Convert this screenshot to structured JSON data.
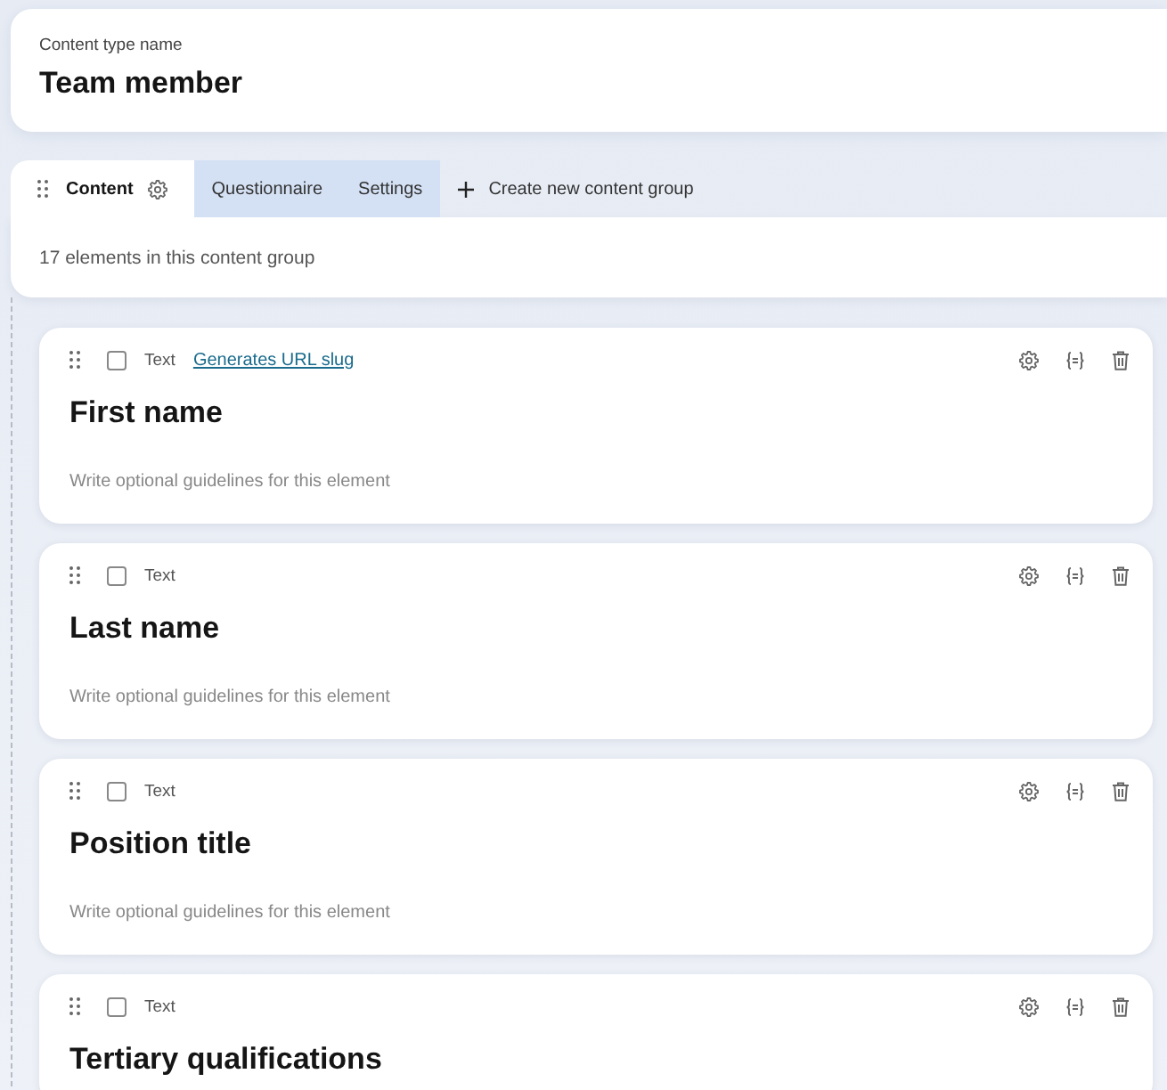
{
  "content_type": {
    "label": "Content type name",
    "name": "Team member"
  },
  "tabs": [
    {
      "label": "Content",
      "selected": true
    },
    {
      "label": "Questionnaire",
      "selected": false
    },
    {
      "label": "Settings",
      "selected": false
    }
  ],
  "create_group_button": {
    "label": "Create new content group"
  },
  "group_summary": "17 elements in this content group",
  "elements": [
    {
      "type": "Text",
      "checked": false,
      "link": "Generates URL slug",
      "title": "First name",
      "guidelines_placeholder": "Write optional guidelines for this element"
    },
    {
      "type": "Text",
      "checked": false,
      "title": "Last name",
      "guidelines_placeholder": "Write optional guidelines for this element"
    },
    {
      "type": "Text",
      "checked": false,
      "title": "Position title",
      "guidelines_placeholder": "Write optional guidelines for this element"
    },
    {
      "type": "Text",
      "checked": false,
      "title": "Tertiary qualifications"
    }
  ]
}
